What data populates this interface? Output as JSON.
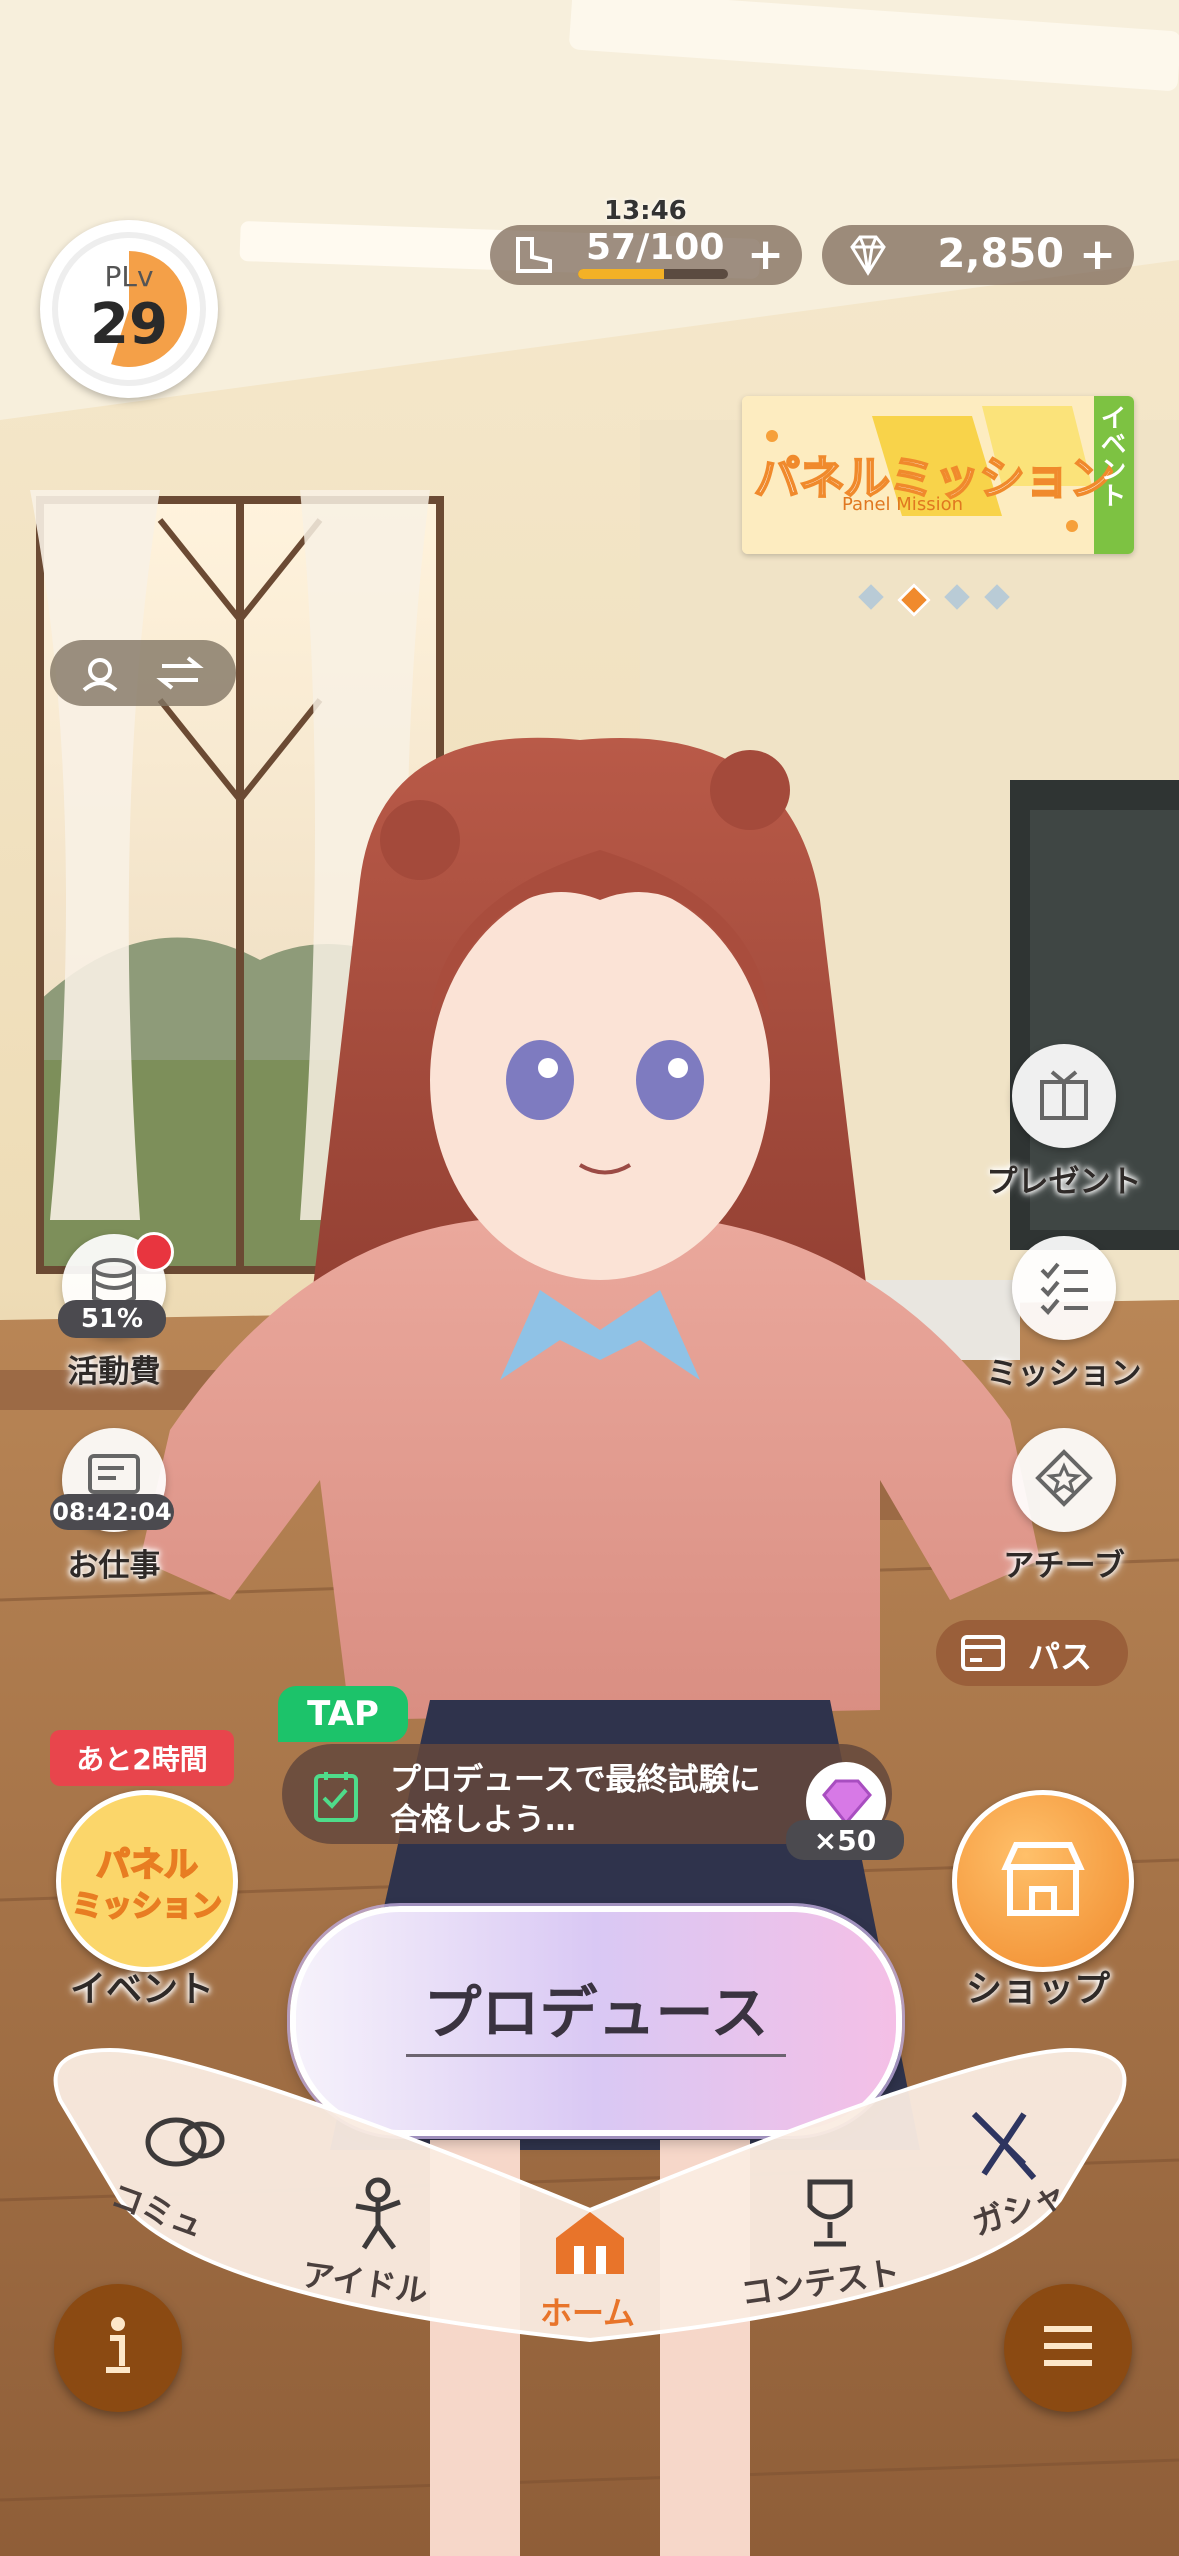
{
  "header": {
    "stamina_timer": "13:46",
    "stamina": "57/100",
    "stamina_fill": 0.57,
    "gems": "2,850",
    "plus": "+",
    "level_prefix": "PLv",
    "level": "29",
    "level_progress": 0.55
  },
  "banner": {
    "title": "パネルミッション",
    "subtitle": "Panel Mission",
    "tag": "イベント",
    "page_count": 4,
    "active_page": 2
  },
  "right_menu": {
    "present": "プレゼント",
    "mission": "ミッション",
    "achieve": "アチーブ",
    "pass": "パス"
  },
  "left_menu": {
    "activity_percent": "51%",
    "activity_label": "活動費",
    "work_timer": "08:42:04",
    "work_label": "お仕事"
  },
  "mission_tip": {
    "tap": "TAP",
    "line1": "プロデュースで最終試験に",
    "line2": "合格しよう…",
    "reward_count": "×50"
  },
  "event": {
    "time_left": "あと2時間",
    "logo_line1": "パネル",
    "logo_line2": "ミッション",
    "label": "イベント"
  },
  "shop": {
    "label": "ショップ"
  },
  "produce": {
    "label": "プロデュース"
  },
  "nav": {
    "commu": "コミュ",
    "idol": "アイドル",
    "home": "ホーム",
    "contest": "コンテスト",
    "gacha": "ガシャ"
  },
  "colors": {
    "accent_orange": "#f08a2c",
    "nav_active": "#e8742a",
    "tap_green": "#1cc36a",
    "alert_red": "#e8353f"
  }
}
